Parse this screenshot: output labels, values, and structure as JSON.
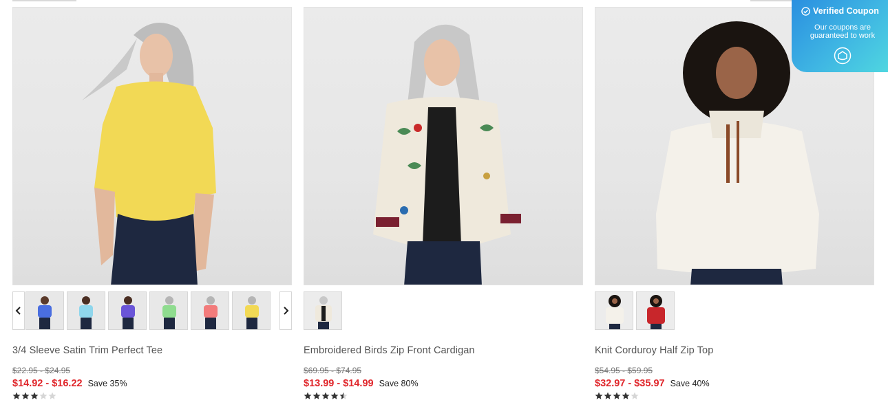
{
  "products": [
    {
      "title": "3/4 Sleeve Satin Trim Perfect Tee",
      "original_price": "$22.95 - $24.95",
      "sale_price": "$14.92 - $16.22",
      "save": "Save 35%",
      "rating": 3,
      "swatches": [
        "blue",
        "light-blue",
        "purple",
        "green",
        "coral",
        "yellow"
      ]
    },
    {
      "title": "Embroidered Birds Zip Front Cardigan",
      "original_price": "$69.95 - $74.95",
      "sale_price": "$13.99 - $14.99",
      "save": "Save 80%",
      "rating": 4.5,
      "swatches": [
        "ivory"
      ]
    },
    {
      "title": "Knit Corduroy Half Zip Top",
      "original_price": "$54.95 - $59.95",
      "sale_price": "$32.97 - $35.97",
      "save": "Save 40%",
      "rating": 4,
      "swatches": [
        "ivory",
        "red"
      ]
    }
  ],
  "coupon": {
    "heading": "Verified Coupon",
    "subtext_line1": "Our coupons are",
    "subtext_line2": "guaranteed to work"
  },
  "icons": {
    "prev": "chevron-left-icon",
    "next": "chevron-right-icon",
    "verified": "check-circle-icon",
    "coupon_logo": "coupon-brand-icon",
    "star": "star-icon"
  },
  "colors": {
    "sale_red": "#e0262b",
    "coupon_gradient_start": "#2a8fe0",
    "coupon_gradient_end": "#4fd6e0",
    "star_filled": "#333333",
    "star_empty": "#d6d6d6"
  }
}
